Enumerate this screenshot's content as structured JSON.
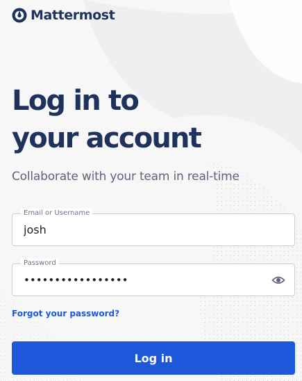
{
  "brand": {
    "name": "Mattermost",
    "logo_icon": "mattermost-logo-icon"
  },
  "login": {
    "title_line1": "Log in to",
    "title_line2": "your account",
    "subtitle": "Collaborate with your team in real-time",
    "email_label": "Email or Username",
    "email_value": "josh",
    "password_label": "Password",
    "password_value": "•••••••••••••••••",
    "show_password_icon": "eye-icon",
    "forgot_link": "Forgot your password?",
    "submit_label": "Log in"
  },
  "colors": {
    "brand_text": "#1e325c",
    "primary": "#1c58d9",
    "background": "#f7f7f8"
  }
}
